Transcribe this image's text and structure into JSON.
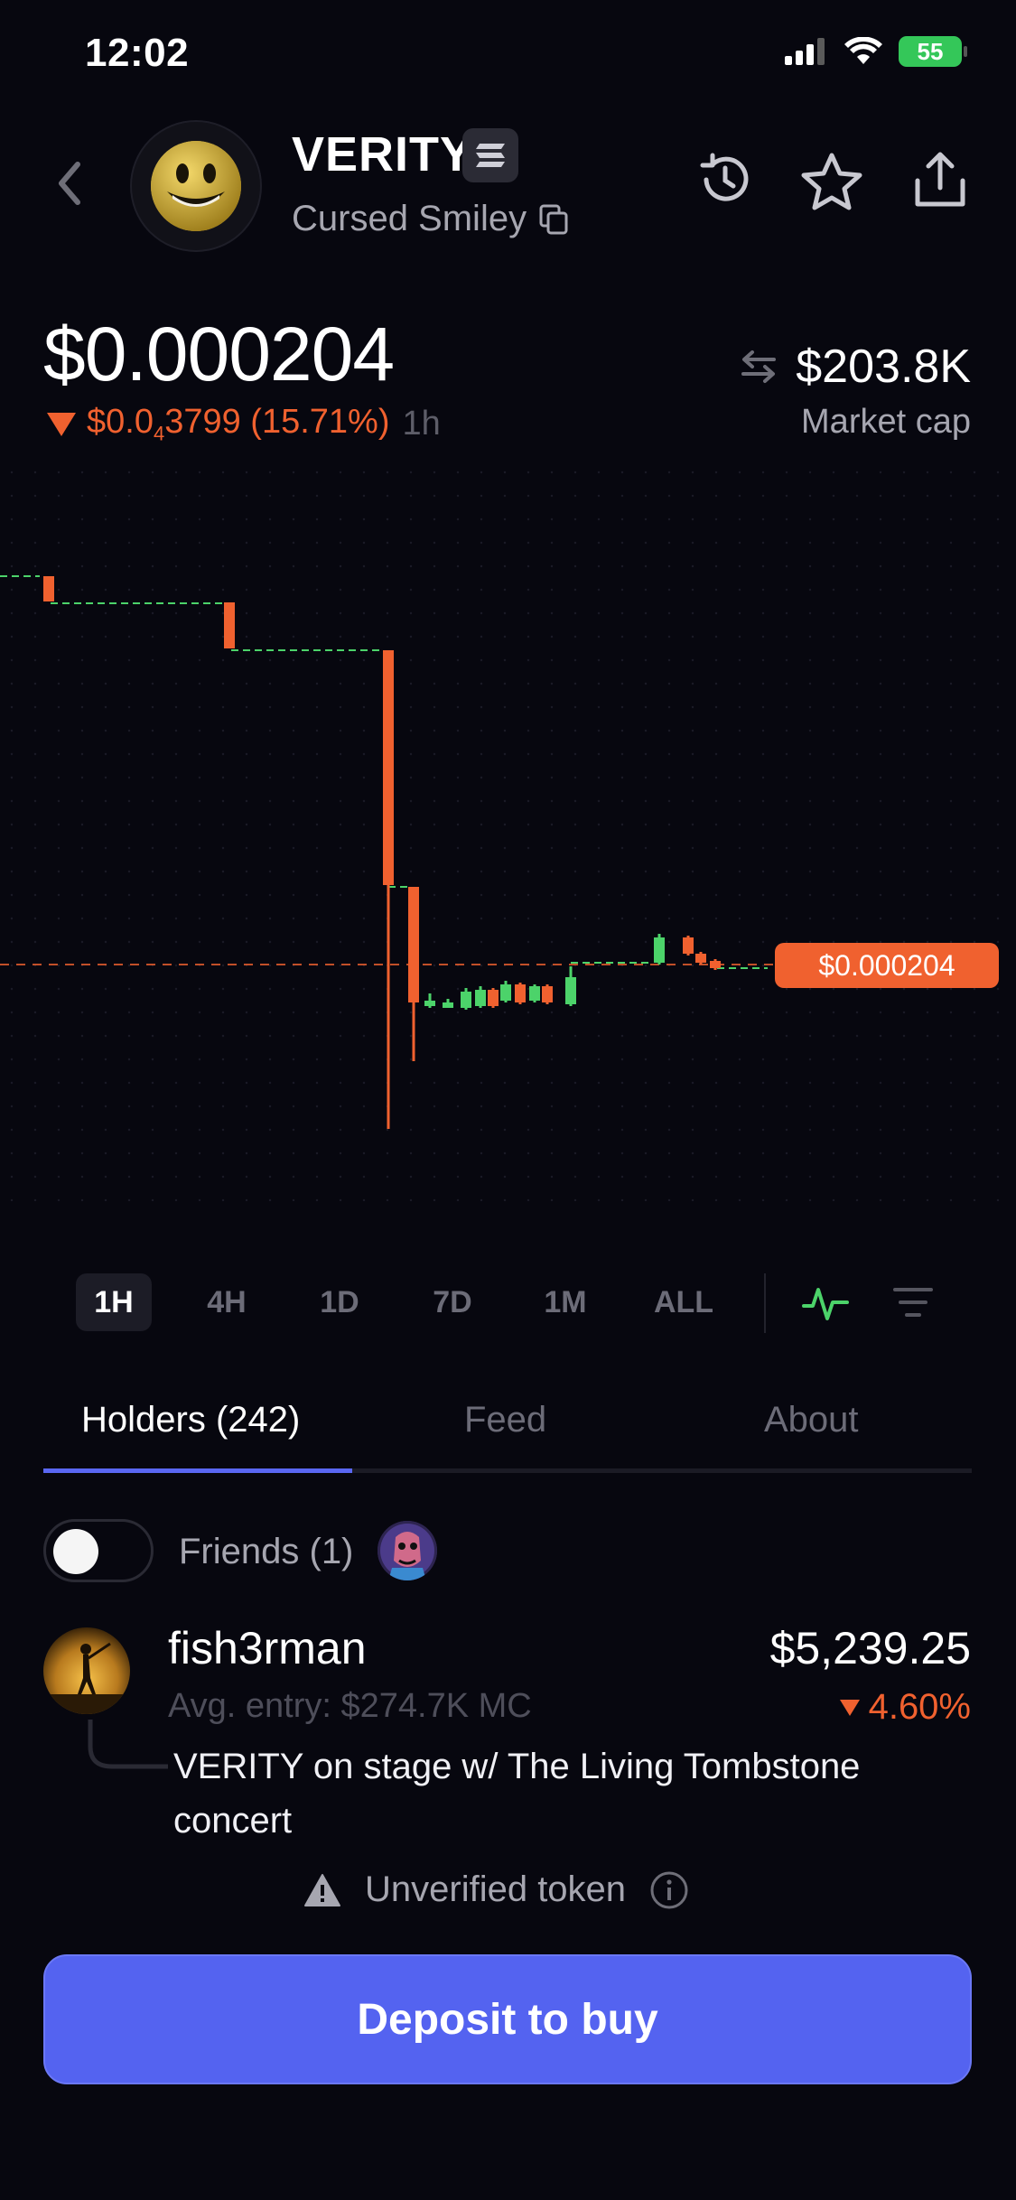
{
  "status_bar": {
    "time": "12:02",
    "battery": "55"
  },
  "header": {
    "token_symbol": "VERITY",
    "token_name": "Cursed Smiley"
  },
  "price": {
    "value": "$0.000204",
    "change_prefix": "$0.0",
    "change_sub": "4",
    "change_suffix": "3799 (15.71%)",
    "change_period": "1h",
    "market_cap": "$203.8K",
    "market_cap_label": "Market cap",
    "current_tag": "$0.000204"
  },
  "chart_data": {
    "type": "candlestick",
    "current_price_label": "$0.000204",
    "candles": [
      {
        "o": 1.0,
        "h": 1.0,
        "l": 0.96,
        "c": 0.96
      },
      {
        "o": 0.96,
        "h": 0.96,
        "l": 0.96,
        "c": 0.96
      },
      {
        "o": 0.96,
        "h": 0.96,
        "l": 0.96,
        "c": 0.96
      },
      {
        "o": 0.96,
        "h": 0.96,
        "l": 0.9,
        "c": 0.9
      },
      {
        "o": 0.9,
        "h": 0.9,
        "l": 0.9,
        "c": 0.9
      },
      {
        "o": 0.9,
        "h": 0.9,
        "l": 0.9,
        "c": 0.9
      },
      {
        "o": 0.9,
        "h": 0.9,
        "l": 0.61,
        "c": 0.61
      },
      {
        "o": 0.61,
        "h": 0.61,
        "l": 0.55,
        "c": 0.55
      },
      {
        "o": 0.55,
        "h": 0.56,
        "l": 0.46,
        "c": 0.47
      }
    ],
    "colors": {
      "up": "#4cd36a",
      "down": "#f0612f",
      "price_line": "#f0612f"
    }
  },
  "timeframes": [
    "1H",
    "4H",
    "1D",
    "7D",
    "1M",
    "ALL"
  ],
  "active_timeframe": "1H",
  "tabs": [
    "Holders (242)",
    "Feed",
    "About"
  ],
  "active_tab": "Holders (242)",
  "friends": {
    "label": "Friends (1)",
    "enabled": false
  },
  "holder": {
    "name": "fish3rman",
    "avg_entry": "Avg. entry: $274.7K MC",
    "value": "$5,239.25",
    "change": "4.60%",
    "note": "VERITY on stage w/ The Living Tombstone concert"
  },
  "warning": {
    "label": "Unverified token"
  },
  "cta": {
    "label": "Deposit to buy"
  },
  "colors": {
    "accent": "#5463f0",
    "down": "#f0612f",
    "up": "#4cd36a",
    "background": "#07070f"
  }
}
